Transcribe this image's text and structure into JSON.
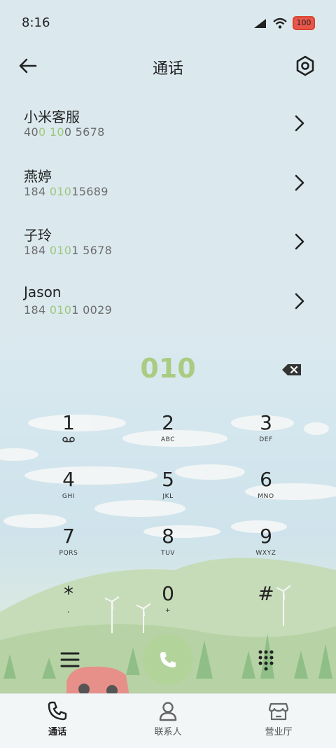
{
  "status_bar": {
    "time": "8:16",
    "battery": "100"
  },
  "header": {
    "title": "通话"
  },
  "contacts": [
    {
      "name": "小米客服",
      "number_parts": [
        "40",
        "0",
        " ",
        "10",
        "0 5678"
      ]
    },
    {
      "name": "燕婷",
      "number_parts": [
        "184 ",
        "010",
        "15689"
      ]
    },
    {
      "name": "子玲",
      "number_parts": [
        "184 ",
        "010",
        "1 5678"
      ]
    },
    {
      "name": "Jason",
      "number_parts": [
        "184 ",
        "010",
        "1 0029"
      ]
    }
  ],
  "dialer": {
    "input": "010",
    "keys": [
      {
        "digit": "1",
        "letters": ""
      },
      {
        "digit": "2",
        "letters": "ABC"
      },
      {
        "digit": "3",
        "letters": "DEF"
      },
      {
        "digit": "4",
        "letters": "GHI"
      },
      {
        "digit": "5",
        "letters": "JKL"
      },
      {
        "digit": "6",
        "letters": "MNO"
      },
      {
        "digit": "7",
        "letters": "PQRS"
      },
      {
        "digit": "8",
        "letters": "TUV"
      },
      {
        "digit": "9",
        "letters": "WXYZ"
      },
      {
        "digit": "*",
        "letters": ","
      },
      {
        "digit": "0",
        "letters": "+"
      },
      {
        "digit": "#",
        "letters": ""
      }
    ]
  },
  "bottom_nav": [
    {
      "label": "通话",
      "icon": "phone-icon",
      "active": true
    },
    {
      "label": "联系人",
      "icon": "person-icon",
      "active": false
    },
    {
      "label": "营业厅",
      "icon": "store-icon",
      "active": false
    }
  ],
  "colors": {
    "accent": "#a9cc82",
    "background": "#dbe9ef",
    "text": "#222222"
  }
}
